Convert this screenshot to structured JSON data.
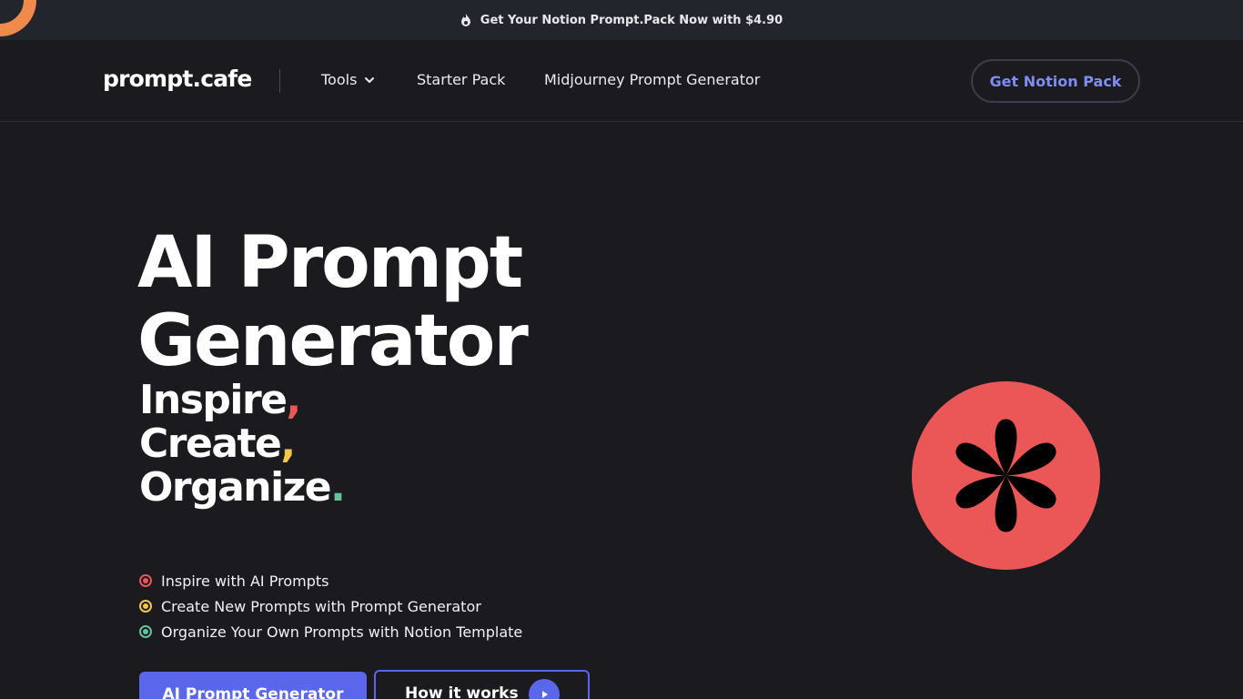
{
  "announcement": {
    "text": "Get Your Notion Prompt.Pack Now with $4.90",
    "icon": "flame-icon"
  },
  "nav": {
    "logo": "prompt.cafe",
    "tools_label": "Tools",
    "starter_label": "Starter Pack",
    "midjourney_label": "Midjourney Prompt Generator",
    "cta_label": "Get Notion Pack"
  },
  "hero": {
    "title_line1": "AI Prompt",
    "title_line2": "Generator",
    "tagline": [
      {
        "word": "Inspire",
        "punct": ","
      },
      {
        "word": "Create",
        "punct": ","
      },
      {
        "word": "Organize",
        "punct": "."
      }
    ],
    "features": [
      "Inspire with AI Prompts",
      "Create New Prompts with Prompt Generator",
      "Organize Your Own Prompts with Notion Template"
    ],
    "primary_button": "AI Prompt Generator",
    "secondary_button": "How it works"
  },
  "colors": {
    "background": "#1b1b1f",
    "accent": "#5b67ea",
    "red": "#e85858",
    "yellow": "#f2c84b",
    "green": "#62c49a",
    "badge": "#eb5757"
  }
}
